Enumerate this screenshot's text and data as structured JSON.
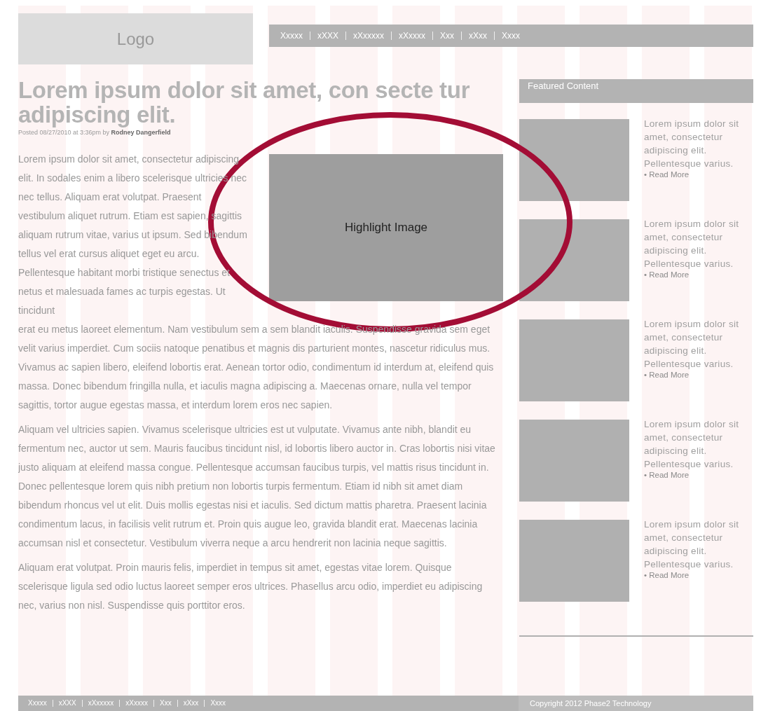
{
  "logo": "Logo",
  "nav": [
    "Xxxxx",
    "xXXX",
    "xXxxxxx",
    "xXxxxx",
    "Xxx",
    "xXxx",
    "Xxxx"
  ],
  "article": {
    "title": "Lorem ipsum dolor sit amet, con secte tur adipiscing elit.",
    "byline": "Posted 08/27/2010 at 3:36pm by **Rodney Dangerfield**",
    "image_label": "Highlight Image",
    "lead": "Lorem ipsum dolor sit amet, consectetur adipiscing elit. In sodales enim a libero scelerisque ultricies nec nec tellus. Aliquam erat volutpat. Praesent vestibulum aliquet rutrum. Etiam est sapien, sagittis aliquam rutrum vitae, varius ut ipsum. Sed bibendum tellus vel erat cursus aliquet eget eu arcu. Pellentesque habitant morbi tristique senectus et netus et malesuada fames ac turpis egestas. Ut tincidunt",
    "paragraphs": [
      "erat eu metus laoreet elementum. Nam vestibulum sem a sem blandit iaculis. Suspendisse gravida sem eget velit varius imperdiet. Cum sociis natoque penatibus et magnis dis parturient montes, nascetur ridiculus mus. Vivamus ac sapien libero, eleifend lobortis erat. Aenean tortor odio, condimentum id interdum at, eleifend quis massa. Donec bibendum fringilla nulla, et iaculis magna adipiscing a. Maecenas ornare, nulla vel tempor sagittis, tortor augue egestas massa, et interdum lorem eros nec sapien.",
      "Aliquam vel ultricies sapien. Vivamus scelerisque ultricies est ut vulputate. Vivamus ante nibh, blandit eu fermentum nec, auctor ut sem. Mauris faucibus tincidunt nisl, id lobortis libero auctor in. Cras lobortis nisi vitae justo aliquam at eleifend massa congue. Pellentesque accumsan faucibus turpis, vel mattis risus tincidunt in. Donec pellentesque lorem quis nibh pretium non lobortis turpis fermentum. Etiam id nibh sit amet diam bibendum rhoncus vel ut elit. Duis mollis egestas nisi et iaculis. Sed dictum mattis pharetra. Praesent lacinia condimentum lacus, in facilisis velit rutrum et. Proin quis augue leo, gravida blandit erat. Maecenas lacinia accumsan nisl et consectetur. Vestibulum viverra neque a arcu hendrerit non lacinia neque sagittis.",
      "Aliquam erat volutpat. Proin mauris felis, imperdiet in tempus sit amet, egestas vitae lorem. Quisque scelerisque ligula sed odio luctus laoreet semper eros ultrices. Phasellus arcu odio, imperdiet eu adipiscing nec, varius non nisl. Suspendisse quis porttitor eros."
    ]
  },
  "sidebar": {
    "title": "Featured Content",
    "items": [
      {
        "text": "Lorem ipsum dolor sit amet, consectetur adipiscing elit. Pellentesque varius.",
        "link": "• Read More"
      },
      {
        "text": "Lorem ipsum dolor sit amet, consectetur adipiscing elit. Pellentesque varius.",
        "link": "• Read More"
      },
      {
        "text": "Lorem ipsum dolor sit amet, consectetur adipiscing elit. Pellentesque varius.",
        "link": "• Read More"
      },
      {
        "text": "Lorem ipsum dolor sit amet, consectetur adipiscing elit. Pellentesque varius.",
        "link": "• Read More"
      },
      {
        "text": "Lorem ipsum dolor sit amet, consectetur adipiscing elit. Pellentesque varius.",
        "link": "• Read More"
      }
    ]
  },
  "footer": {
    "nav": [
      "Xxxxx",
      "xXXX",
      "xXxxxxx",
      "xXxxxx",
      "Xxx",
      "xXxx",
      "Xxxx"
    ],
    "copyright": "Copyright 2012 Phase2 Technology"
  }
}
